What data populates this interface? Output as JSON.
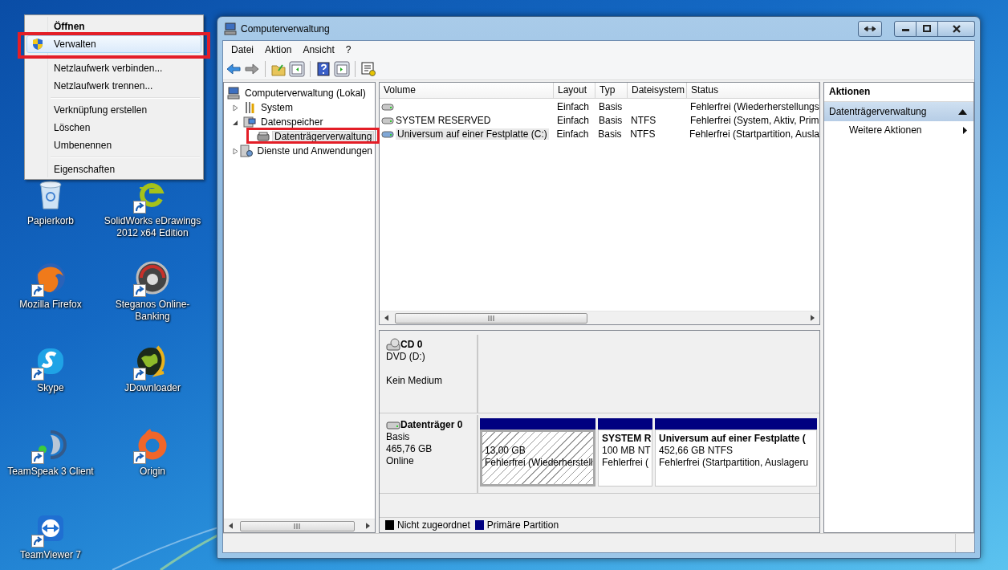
{
  "desktop_icons": [
    {
      "label": "Papierkorb",
      "shortcut": false
    },
    {
      "label": "SolidWorks eDrawings 2012 x64 Edition",
      "shortcut": true
    },
    {
      "label": "Mozilla Firefox",
      "shortcut": true
    },
    {
      "label": "Steganos Online-Banking",
      "shortcut": true
    },
    {
      "label": "Skype",
      "shortcut": true
    },
    {
      "label": "JDownloader",
      "shortcut": true
    },
    {
      "label": "TeamSpeak 3 Client",
      "shortcut": true
    },
    {
      "label": "Origin",
      "shortcut": true
    },
    {
      "label": "TeamViewer 7",
      "shortcut": true
    }
  ],
  "context_menu": {
    "groups": [
      {
        "items": [
          {
            "label": "Öffnen",
            "default": true,
            "selected": false
          },
          {
            "label": "Verwalten",
            "default": false,
            "selected": true
          }
        ]
      },
      {
        "items": [
          {
            "label": "Netzlaufwerk verbinden...",
            "default": false,
            "selected": false
          },
          {
            "label": "Netzlaufwerk trennen...",
            "default": false,
            "selected": false
          }
        ]
      },
      {
        "items": [
          {
            "label": "Verknüpfung erstellen",
            "default": false,
            "selected": false
          },
          {
            "label": "Löschen",
            "default": false,
            "selected": false
          },
          {
            "label": "Umbenennen",
            "default": false,
            "selected": false
          }
        ]
      },
      {
        "items": [
          {
            "label": "Eigenschaften",
            "default": false,
            "selected": false
          }
        ]
      }
    ]
  },
  "window": {
    "title": "Computerverwaltung",
    "menu": [
      "Datei",
      "Aktion",
      "Ansicht",
      "?"
    ],
    "tree": {
      "label": "Computerverwaltung (Lokal)",
      "selected": false,
      "children": [
        {
          "label": "System",
          "expanded": false,
          "selected": false
        },
        {
          "label": "Datenspeicher",
          "expanded": true,
          "selected": false,
          "children": [
            {
              "label": "Datenträgerverwaltung",
              "selected": true
            }
          ]
        },
        {
          "label": "Dienste und Anwendungen",
          "expanded": false,
          "selected": false
        }
      ]
    },
    "volumes": {
      "columns": [
        "Volume",
        "Layout",
        "Typ",
        "Dateisystem",
        "Status"
      ],
      "rows": [
        {
          "layout": "Einfach",
          "type": "Basis",
          "status": "Fehlerfrei (Wiederherstellungs",
          "selected": false
        },
        {
          "volume": "SYSTEM RESERVED",
          "layout": "Einfach",
          "type": "Basis",
          "file_system": "NTFS",
          "status": "Fehlerfrei (System, Aktiv, Prim",
          "selected": false
        },
        {
          "volume": "Universum auf einer Festplatte (C:)",
          "layout": "Einfach",
          "type": "Basis",
          "file_system": "NTFS",
          "status": "Fehlerfrei (Startpartition, Ausla",
          "selected": true
        }
      ]
    },
    "disks": [
      {
        "kind": "cdrom",
        "name": "CD 0",
        "type": "DVD (D:)",
        "status": "Kein Medium"
      },
      {
        "kind": "disk",
        "name": "Datenträger 0",
        "type": "Basis",
        "size": "465,76 GB",
        "status": "Online",
        "partitions": [
          {
            "size": "13,00 GB",
            "status": "Fehlerfrei (Wiederherstell",
            "selected": true,
            "color": "#000080"
          },
          {
            "title": "SYSTEM R",
            "size": "100 MB NT",
            "status": "Fehlerfrei (",
            "selected": false,
            "color": "#000080"
          },
          {
            "title": "Universum auf einer Festplatte (",
            "size": "452,66 GB NTFS",
            "status": "Fehlerfrei (Startpartition, Auslageru",
            "selected": false,
            "color": "#000080"
          }
        ]
      }
    ],
    "legend": [
      {
        "label": "Nicht zugeordnet",
        "color": "#000000"
      },
      {
        "label": "Primäre Partition",
        "color": "#000080"
      }
    ],
    "actions": {
      "title": "Aktionen",
      "section": {
        "label": "Datenträgerverwaltung",
        "expanded": true
      },
      "items": [
        "Weitere Aktionen"
      ]
    }
  }
}
